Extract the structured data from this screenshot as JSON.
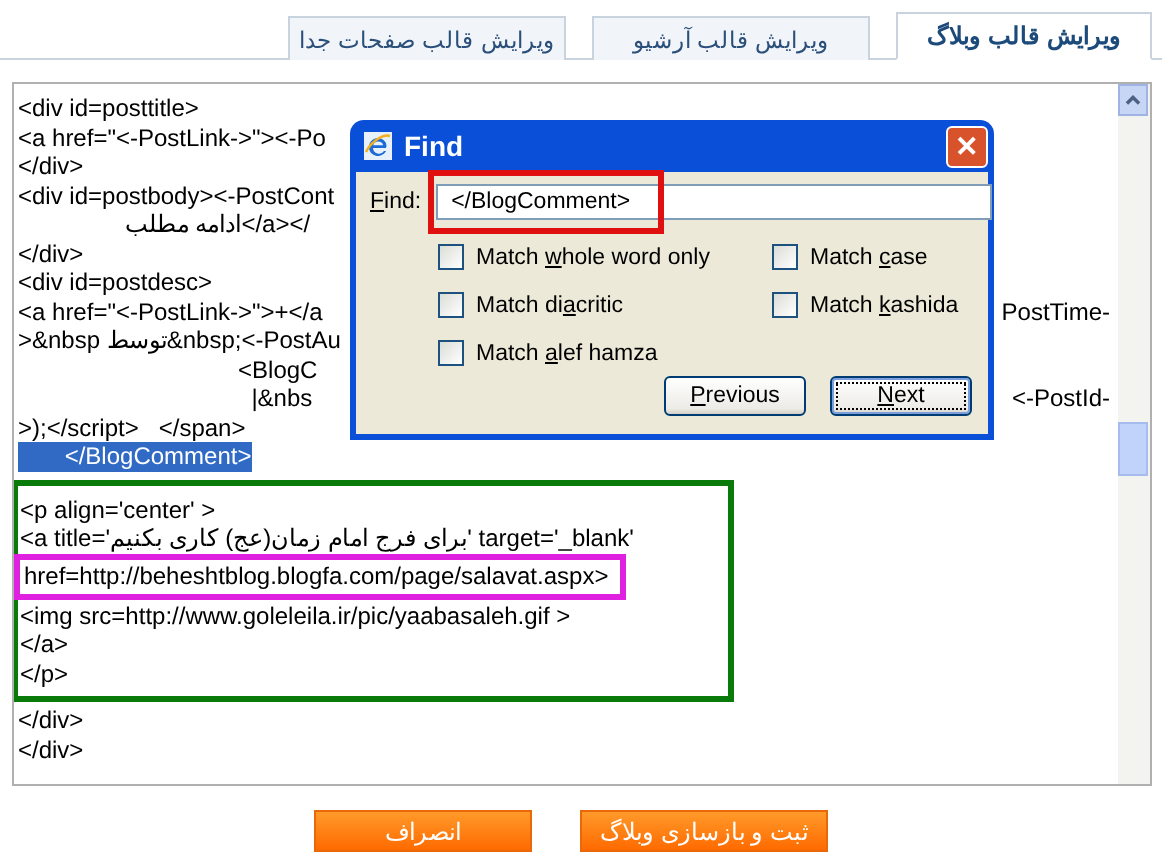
{
  "tabs": [
    {
      "label": "ویرایش قالب وبلاگ",
      "selected": true
    },
    {
      "label": "ویرایش قالب آرشیو",
      "selected": false
    },
    {
      "label": "ویرایش قالب صفحات جدا",
      "selected": false
    }
  ],
  "editor": {
    "lines": [
      {
        "text": "<div id=posttitle>",
        "selected": false
      },
      {
        "text": "<a href=\"<-PostLink->\"><-Po",
        "selected": false
      },
      {
        "text": "</div>",
        "selected": false
      },
      {
        "text": "<div id=postbody><-PostCont",
        "selected": false
      },
      {
        "text": "                ادامه مطلب</a></",
        "selected": false
      },
      {
        "text": "</div>",
        "selected": false
      },
      {
        "text": "<div id=postdesc>",
        "selected": false
      },
      {
        "text": "<a href=\"<-PostLink->\">+</a",
        "right": "PostTime-",
        "selected": false
      },
      {
        "text": ">&nbsp توسط&nbsp;<-PostAu",
        "selected": false
      },
      {
        "text": "                                 <BlogC",
        "selected": false
      },
      {
        "text": "                                   |&nbs",
        "right": "<-PostId-",
        "selected": false
      },
      {
        "text": ">);</script>   </span>",
        "selected": false
      },
      {
        "text": "       </BlogComment>",
        "selected": true
      }
    ],
    "framed_lines": [
      {
        "text": "<p align='center' >",
        "selected": false
      },
      {
        "text": "<a title='برای فرج امام زمان(عج) کاری بکنیم' target='_blank'",
        "selected": false
      },
      {
        "text": "href=http://beheshtblog.blogfa.com/page/salavat.aspx>",
        "selected": false,
        "framed": true
      },
      {
        "text": "<img src=http://www.goleleila.ir/pic/yaabasaleh.gif >",
        "selected": false
      },
      {
        "text": "</a>",
        "selected": false
      },
      {
        "text": "</p>",
        "selected": false
      }
    ],
    "lines_after": [
      {
        "text": "</div>",
        "selected": false
      },
      {
        "text": "</div>",
        "selected": false
      }
    ]
  },
  "find_dialog": {
    "title": "Find",
    "close": "✕",
    "field": {
      "label": {
        "key": "F",
        "after": "ind:"
      },
      "value": "</BlogComment>"
    },
    "options": [
      {
        "label": {
          "before": "Match ",
          "key": "w",
          "after": "hole word only"
        },
        "checked": false
      },
      {
        "label": {
          "before": "Match ",
          "key": "c",
          "after": "ase"
        },
        "checked": false
      },
      {
        "label": {
          "before": "Match di",
          "key": "a",
          "after": "critic"
        },
        "checked": false
      },
      {
        "label": {
          "before": "Match ",
          "key": "k",
          "after": "ashida"
        },
        "checked": false
      },
      {
        "label": {
          "before": "Match ",
          "key": "a",
          "after": "lef hamza"
        },
        "checked": false
      }
    ],
    "buttons": [
      {
        "label": {
          "key": "P",
          "after": "revious"
        },
        "selected": false
      },
      {
        "label": {
          "key": "N",
          "after": "ext"
        },
        "selected": true
      }
    ]
  },
  "actions": [
    {
      "label": "ثبت و بازسازی وبلاگ"
    },
    {
      "label": "انصراف"
    }
  ]
}
